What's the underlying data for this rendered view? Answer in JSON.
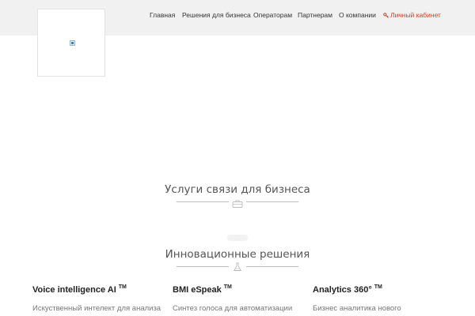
{
  "nav": {
    "items": [
      {
        "label": "Главная"
      },
      {
        "label": "Решения для бизнеса"
      },
      {
        "label": "Операторам"
      },
      {
        "label": "Партнерам"
      },
      {
        "label": "О компании"
      },
      {
        "label": "Личный кабинет"
      }
    ]
  },
  "sections": {
    "telecom_title": "Услуги связи для бизнеса",
    "innovative_title": "Инновационные решения"
  },
  "products": [
    {
      "name": "Voice intelligence AI",
      "mark": "TM",
      "description": "Искуственный интелект для анализа"
    },
    {
      "name": "BMI eSpeak",
      "mark": "TM",
      "description": "Синтез голоса для автоматизации"
    },
    {
      "name": "Analytics 360°",
      "mark": "TM",
      "description": "Бизнес аналитика нового"
    }
  ],
  "colors": {
    "header_bg": "#f1f1f1",
    "accent": "#d9402b",
    "title_text": "#555555"
  },
  "icons": {
    "account": "key-icon",
    "telecom_divider": "briefcase-icon",
    "innovative_divider": "flask-icon"
  }
}
